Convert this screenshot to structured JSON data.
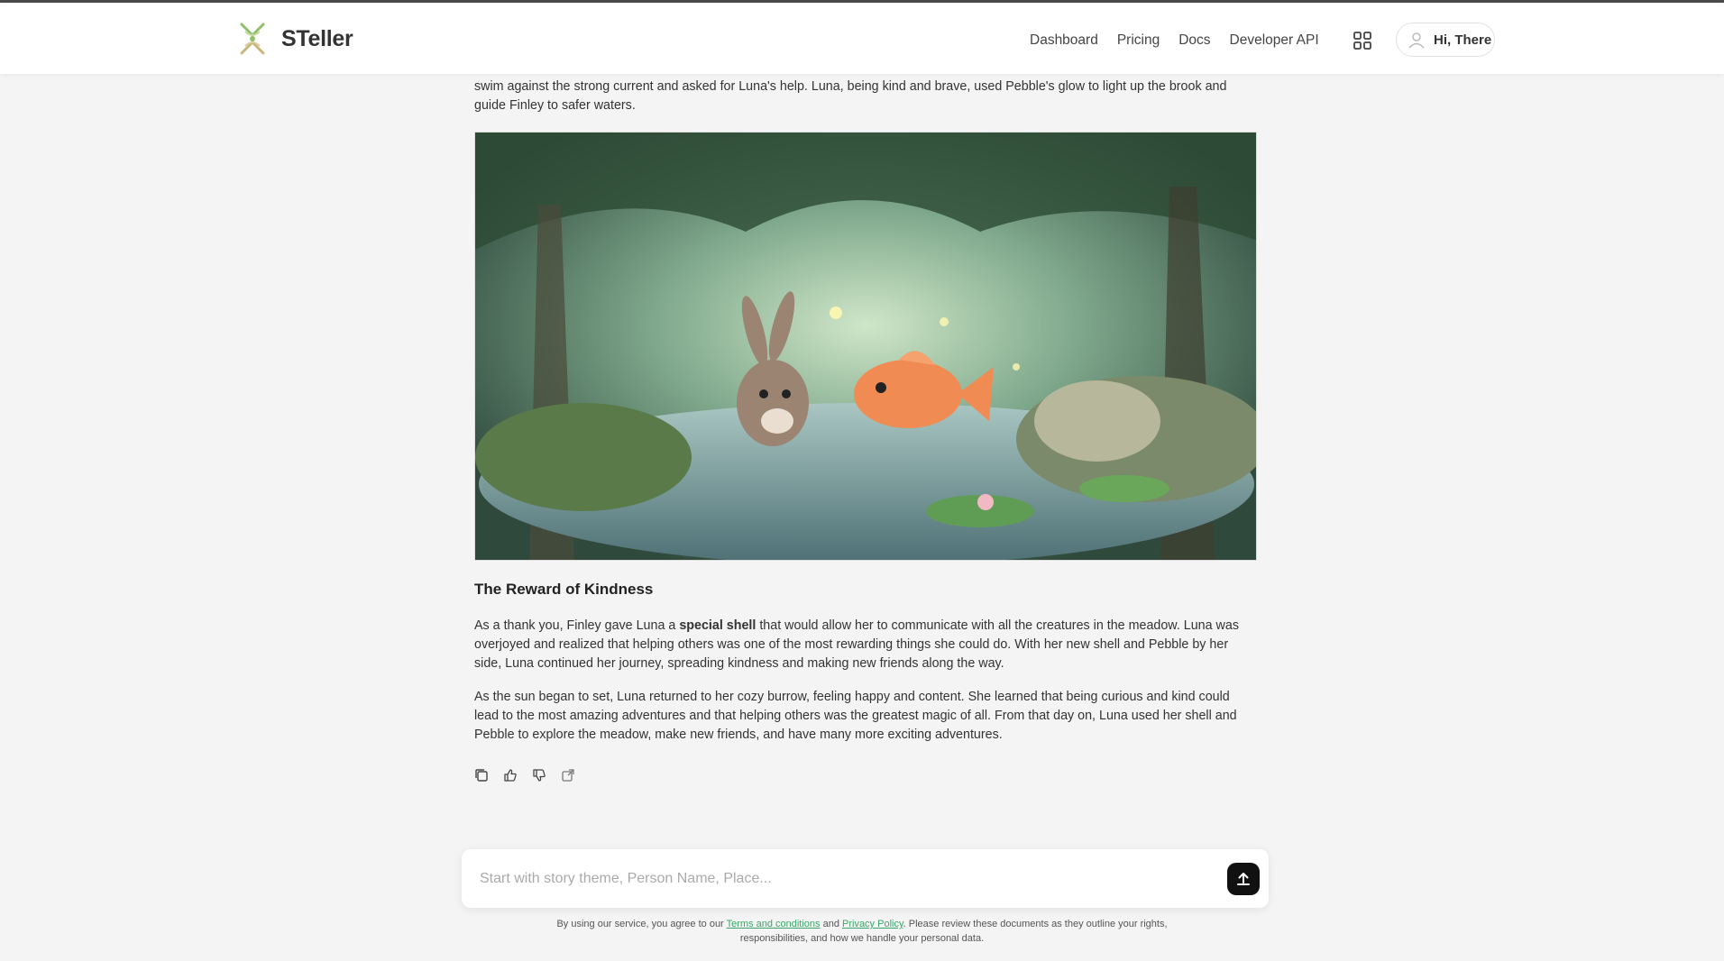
{
  "app": {
    "brand_name": "STeller"
  },
  "nav": {
    "items": [
      {
        "label": "Dashboard"
      },
      {
        "label": "Pricing"
      },
      {
        "label": "Docs"
      },
      {
        "label": "Developer API"
      }
    ]
  },
  "user": {
    "greeting": "Hi, There"
  },
  "story": {
    "intro_paragraph": "swim against the strong current and asked for Luna's help. Luna, being kind and brave, used Pebble's glow to light up the brook and guide Finley to safer waters.",
    "image_alt": "Illustration of a bunny and a goldfish in a forest pond",
    "section_title": "The Reward of Kindness",
    "p1_before": "As a thank you, Finley gave Luna a ",
    "p1_bold": "special shell",
    "p1_after": " that would allow her to communicate with all the creatures in the meadow. Luna was overjoyed and realized that helping others was one of the most rewarding things she could do. With her new shell and Pebble by her side, Luna continued her journey, spreading kindness and making new friends along the way.",
    "p2": "As the sun began to set, Luna returned to her cozy burrow, feeling happy and content. She learned that being curious and kind could lead to the most amazing adventures and that helping others was the greatest magic of all. From that day on, Luna used her shell and Pebble to explore the meadow, make new friends, and have many more exciting adventures."
  },
  "actions": [
    {
      "icon": "copy-icon"
    },
    {
      "icon": "thumbs-up-icon"
    },
    {
      "icon": "thumbs-down-icon"
    },
    {
      "icon": "share-icon"
    }
  ],
  "composer": {
    "placeholder": "Start with story theme, Person Name, Place..."
  },
  "footer": {
    "text_before": "By using our service, you agree to our ",
    "terms_link": "Terms and conditions",
    "text_mid": " and ",
    "privacy_link": "Privacy Policy",
    "text_after": ". Please review these documents as they outline your rights, responsibilities, and how we handle your personal data."
  },
  "colors": {
    "background": "#f4f4f4",
    "link": "#3aa56a",
    "send_button": "#111111"
  }
}
